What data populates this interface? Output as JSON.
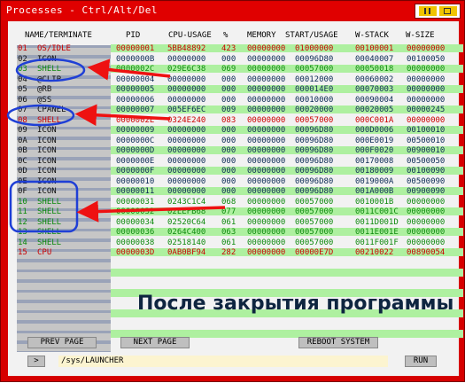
{
  "window": {
    "title": "Processes - Ctrl/Alt/Del"
  },
  "headers": {
    "name": "NAME/TERMINATE",
    "pid": "PID",
    "cpu_usage": "CPU-USAGE",
    "percent": "%",
    "memory": "MEMORY",
    "start_usage": "START/USAGE",
    "w_stack": "W-STACK",
    "w_size": "W-SIZE"
  },
  "rows": [
    {
      "num": "01",
      "name": "OS/IDLE",
      "pid": "00000001",
      "cpu": "5BB48892",
      "pct": "423",
      "memory": "00000000",
      "start": "01000000",
      "wstack": "00100001",
      "wsize": "00000000"
    },
    {
      "num": "02",
      "name": "ICON",
      "pid": "0000000B",
      "cpu": "00000000",
      "pct": "000",
      "memory": "00000000",
      "start": "00096D80",
      "wstack": "00040007",
      "wsize": "00100050"
    },
    {
      "num": "03",
      "name": "SHELL",
      "pid": "0000002C",
      "cpu": "029E6C38",
      "pct": "069",
      "memory": "00000000",
      "start": "00057000",
      "wstack": "00050018",
      "wsize": "00000000"
    },
    {
      "num": "04",
      "name": "@CLIP",
      "pid": "00000004",
      "cpu": "00000000",
      "pct": "000",
      "memory": "00000000",
      "start": "00012000",
      "wstack": "00060002",
      "wsize": "00000000"
    },
    {
      "num": "05",
      "name": "@RB",
      "pid": "00000005",
      "cpu": "00000000",
      "pct": "000",
      "memory": "00000000",
      "start": "000014E0",
      "wstack": "00070003",
      "wsize": "00000000"
    },
    {
      "num": "06",
      "name": "@SS",
      "pid": "00000006",
      "cpu": "00000000",
      "pct": "000",
      "memory": "00000000",
      "start": "00010000",
      "wstack": "00090004",
      "wsize": "00000000"
    },
    {
      "num": "07",
      "name": "CPANEL",
      "pid": "00000007",
      "cpu": "005EF6EC",
      "pct": "009",
      "memory": "00000000",
      "start": "00020000",
      "wstack": "00020005",
      "wsize": "00000245"
    },
    {
      "num": "08",
      "name": "SHELL",
      "pid": "0000002E",
      "cpu": "0324E240",
      "pct": "083",
      "memory": "00000000",
      "start": "00057000",
      "wstack": "000C001A",
      "wsize": "00000000"
    },
    {
      "num": "09",
      "name": "ICON",
      "pid": "00000009",
      "cpu": "00000000",
      "pct": "000",
      "memory": "00000000",
      "start": "00096D80",
      "wstack": "000D0006",
      "wsize": "00100010"
    },
    {
      "num": "0A",
      "name": "ICON",
      "pid": "0000000C",
      "cpu": "00000000",
      "pct": "000",
      "memory": "00000000",
      "start": "00096D80",
      "wstack": "000E0019",
      "wsize": "00500010"
    },
    {
      "num": "0B",
      "name": "ICON",
      "pid": "0000000D",
      "cpu": "00000000",
      "pct": "000",
      "memory": "00000000",
      "start": "00096D80",
      "wstack": "000F0020",
      "wsize": "00900010"
    },
    {
      "num": "0C",
      "name": "ICON",
      "pid": "0000000E",
      "cpu": "00000000",
      "pct": "000",
      "memory": "00000000",
      "start": "00096D80",
      "wstack": "00170008",
      "wsize": "00500050"
    },
    {
      "num": "0D",
      "name": "ICON",
      "pid": "0000000F",
      "cpu": "00000000",
      "pct": "000",
      "memory": "00000000",
      "start": "00096D80",
      "wstack": "00180009",
      "wsize": "00100090"
    },
    {
      "num": "0E",
      "name": "ICON",
      "pid": "00000010",
      "cpu": "00000000",
      "pct": "000",
      "memory": "00000000",
      "start": "00096D80",
      "wstack": "0019000A",
      "wsize": "00500090"
    },
    {
      "num": "0F",
      "name": "ICON",
      "pid": "00000011",
      "cpu": "00000000",
      "pct": "000",
      "memory": "00000000",
      "start": "00096D80",
      "wstack": "001A000B",
      "wsize": "00900090"
    },
    {
      "num": "10",
      "name": "SHELL",
      "pid": "00000031",
      "cpu": "0243C1C4",
      "pct": "068",
      "memory": "00000000",
      "start": "00057000",
      "wstack": "0010001B",
      "wsize": "00000000"
    },
    {
      "num": "11",
      "name": "SHELL",
      "pid": "00000032",
      "cpu": "02EEFB68",
      "pct": "077",
      "memory": "00000000",
      "start": "00057000",
      "wstack": "0011C001C",
      "wsize": "00000000"
    },
    {
      "num": "12",
      "name": "SHELL",
      "pid": "00000034",
      "cpu": "02520C64",
      "pct": "061",
      "memory": "00000000",
      "start": "00057000",
      "wstack": "0011D001D",
      "wsize": "00000000"
    },
    {
      "num": "13",
      "name": "SHELL",
      "pid": "00000036",
      "cpu": "0264C400",
      "pct": "063",
      "memory": "00000000",
      "start": "00057000",
      "wstack": "0011E001E",
      "wsize": "00000000"
    },
    {
      "num": "14",
      "name": "SHELL",
      "pid": "00000038",
      "cpu": "02518140",
      "pct": "061",
      "memory": "00000000",
      "start": "00057000",
      "wstack": "0011F001F",
      "wsize": "00000000"
    },
    {
      "num": "15",
      "name": "CPU",
      "pid": "0000003D",
      "cpu": "0AB0BF94",
      "pct": "282",
      "memory": "00000000",
      "start": "00000E7D",
      "wstack": "00210022",
      "wsize": "00890054"
    }
  ],
  "overlay_text": "После закрытия программы",
  "buttons": {
    "prev_page": "PREV PAGE",
    "next_page": "NEXT PAGE",
    "reboot": "REBOOT SYSTEM",
    "prompt": ">",
    "run": "RUN"
  },
  "command_input": {
    "value": "/sys/LAUNCHER"
  },
  "colors": {
    "window_red": "#d60000",
    "grid_green": "#aef0a0",
    "name_panel_blue": "#9aa3b8",
    "annotation_blue": "#1f3fd6",
    "annotation_red": "#ee1111"
  }
}
